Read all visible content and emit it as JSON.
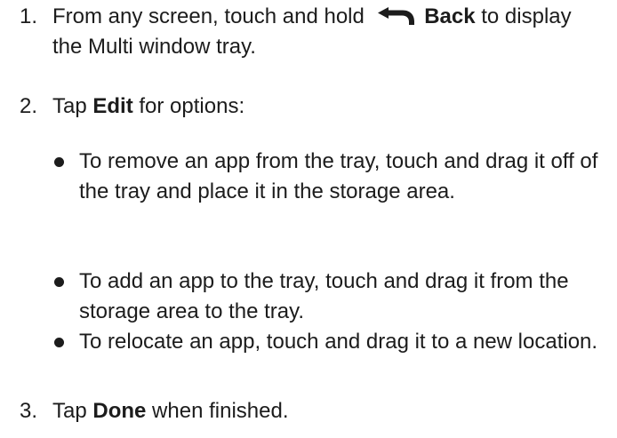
{
  "steps": [
    {
      "number": "1.",
      "text_before": "From any screen, touch and hold",
      "icon": "back-arrow-icon",
      "bold": "Back",
      "text_after": "to display the Multi window tray."
    },
    {
      "number": "2.",
      "text_before": "Tap",
      "bold": "Edit",
      "text_after": "for options:"
    },
    {
      "number": "3.",
      "text_before": "Tap",
      "bold": "Done",
      "text_after": "when finished."
    }
  ],
  "bullets": [
    "To remove an app from the tray, touch and drag it off of the tray and place it in the storage area.",
    "To add an app to the tray, touch and drag it from the storage area to the tray.",
    "To relocate an app, touch and drag it to a new location."
  ]
}
